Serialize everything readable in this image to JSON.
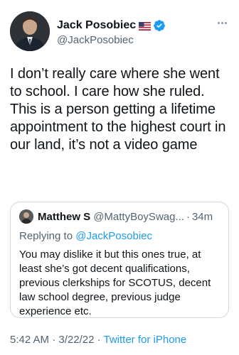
{
  "author": {
    "name": "Jack Posobiec",
    "handle": "@JackPosobiec"
  },
  "tweet": {
    "text": "I don’t really care where she went to school. I care how she ruled. This is a person getting a lifetime appointment to the highest court in our land, it’s not a video game"
  },
  "quoted": {
    "name": "Matthew S",
    "handle": "@MattyBoySwag...",
    "separator": "·",
    "time": "34m",
    "replying_prefix": "Replying to ",
    "replying_to": "@JackPosobiec",
    "text": "You may dislike it but this ones true, at least she’s got decent qualifications, previous clerkships for SCOTUS, decent law school degree, previous judge experience etc."
  },
  "meta": {
    "time": "5:42 AM",
    "sep1": " · ",
    "date": "3/22/22",
    "sep2": " · ",
    "source": "Twitter for iPhone"
  },
  "colors": {
    "link": "#1d9bf0",
    "secondary_text": "#536471",
    "primary_text": "#0f1419",
    "border": "#cfd9de"
  },
  "icons": [
    "us-flag-icon",
    "verified-badge-icon",
    "more-options-icon"
  ]
}
